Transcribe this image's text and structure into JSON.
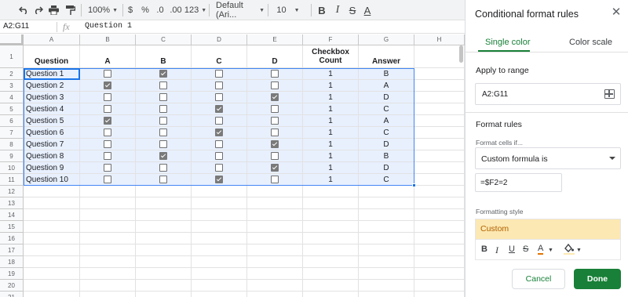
{
  "toolbar": {
    "zoom": "100%",
    "currency": "$",
    "percent": "%",
    "decrease_decimal": ".0",
    "increase_decimal": ".00",
    "more_formats": "123",
    "font": "Default (Ari...",
    "font_size": "10",
    "bold": "B",
    "italic": "I",
    "strike": "S",
    "text_color": "A"
  },
  "formula_bar": {
    "name_box": "A2:G11",
    "fx": "fx",
    "value": "Question 1"
  },
  "columns": [
    "A",
    "B",
    "C",
    "D",
    "E",
    "F",
    "G",
    "H"
  ],
  "rows": [
    "1",
    "2",
    "3",
    "4",
    "5",
    "6",
    "7",
    "8",
    "9",
    "10",
    "11",
    "12",
    "13",
    "14",
    "15",
    "16",
    "17",
    "18",
    "19",
    "20",
    "21"
  ],
  "headers": {
    "question": "Question",
    "a": "A",
    "b": "B",
    "c": "C",
    "d": "D",
    "count_line1": "Checkbox",
    "count_line2": "Count",
    "answer": "Answer"
  },
  "data_rows": [
    {
      "question": "Question 1",
      "checks": [
        false,
        true,
        false,
        false
      ],
      "count": "1",
      "answer": "B"
    },
    {
      "question": "Question 2",
      "checks": [
        true,
        false,
        false,
        false
      ],
      "count": "1",
      "answer": "A"
    },
    {
      "question": "Question 3",
      "checks": [
        false,
        false,
        false,
        true
      ],
      "count": "1",
      "answer": "D"
    },
    {
      "question": "Question 4",
      "checks": [
        false,
        false,
        true,
        false
      ],
      "count": "1",
      "answer": "C"
    },
    {
      "question": "Question 5",
      "checks": [
        true,
        false,
        false,
        false
      ],
      "count": "1",
      "answer": "A"
    },
    {
      "question": "Question 6",
      "checks": [
        false,
        false,
        true,
        false
      ],
      "count": "1",
      "answer": "C"
    },
    {
      "question": "Question 7",
      "checks": [
        false,
        false,
        false,
        true
      ],
      "count": "1",
      "answer": "D"
    },
    {
      "question": "Question 8",
      "checks": [
        false,
        true,
        false,
        false
      ],
      "count": "1",
      "answer": "B"
    },
    {
      "question": "Question 9",
      "checks": [
        false,
        false,
        false,
        true
      ],
      "count": "1",
      "answer": "D"
    },
    {
      "question": "Question 10",
      "checks": [
        false,
        false,
        true,
        false
      ],
      "count": "1",
      "answer": "C"
    }
  ],
  "panel": {
    "title": "Conditional format rules",
    "tab_single": "Single color",
    "tab_scale": "Color scale",
    "apply_label": "Apply to range",
    "range": "A2:G11",
    "format_rules_label": "Format rules",
    "format_cells_if": "Format cells if...",
    "condition": "Custom formula is",
    "formula": "=$F2=2",
    "formatting_style_label": "Formatting style",
    "style_preview": "Custom",
    "style_bold": "B",
    "style_italic": "I",
    "style_underline": "U",
    "style_strike": "S",
    "style_text_color": "A",
    "cancel": "Cancel",
    "done": "Done",
    "colors": {
      "accent": "#188038",
      "preview_bg": "#fce8b2",
      "preview_text": "#b06000"
    }
  }
}
